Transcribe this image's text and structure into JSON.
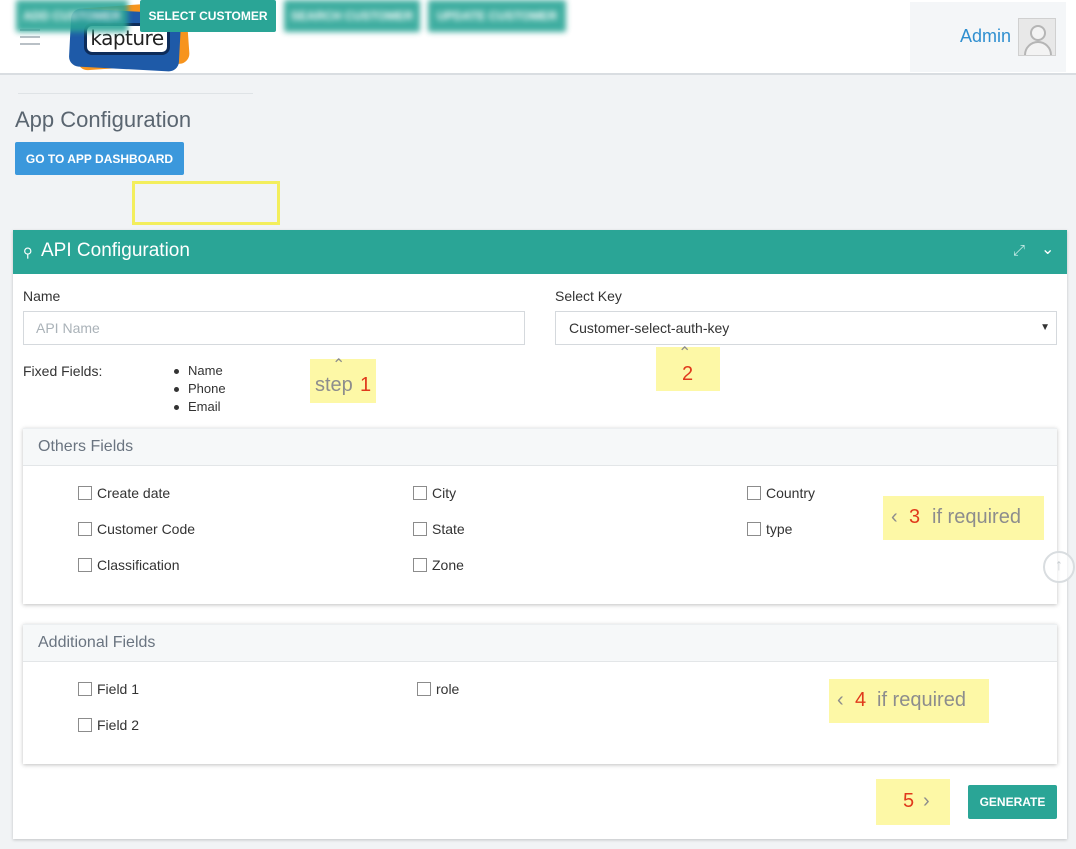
{
  "header": {
    "logo_text": "kapture",
    "user_name": "Admin"
  },
  "page": {
    "title": "App Configuration",
    "dashboard_button": "GO TO APP DASHBOARD"
  },
  "tabs": [
    {
      "label": "ADD CUSTOMER",
      "blurred": true
    },
    {
      "label": "SELECT CUSTOMER",
      "blurred": false,
      "active": true
    },
    {
      "label": "SEARCH CUSTOMER",
      "blurred": true
    },
    {
      "label": "UPDATE CUSTOMER",
      "blurred": true
    }
  ],
  "panel": {
    "title": "API Configuration",
    "name_label": "Name",
    "name_placeholder": "API Name",
    "name_value": "",
    "key_label": "Select Key",
    "key_value": "Customer-select-auth-key",
    "fixed_label": "Fixed Fields:",
    "fixed_fields": [
      "Name",
      "Phone",
      "Email"
    ]
  },
  "others": {
    "title": "Others Fields",
    "fields": [
      "Create date",
      "City",
      "Country",
      "Customer Code",
      "State",
      "type",
      "Classification",
      "Zone"
    ]
  },
  "additional": {
    "title": "Additional Fields",
    "fields": [
      "Field 1",
      "role",
      "Field 2"
    ]
  },
  "annotations": {
    "step1_word": "step",
    "step1_num": "1",
    "step2_num": "2",
    "step3_num": "3",
    "step3_text": "if required",
    "step4_num": "4",
    "step4_text": "if required",
    "step5_num": "5",
    "color": "#fdf8a6",
    "num_color": "#e03a1c"
  },
  "generate_button": "GENERATE",
  "colors": {
    "teal": "#2aa596",
    "blue": "#3b98dc",
    "highlight": "#f3ee5c"
  }
}
